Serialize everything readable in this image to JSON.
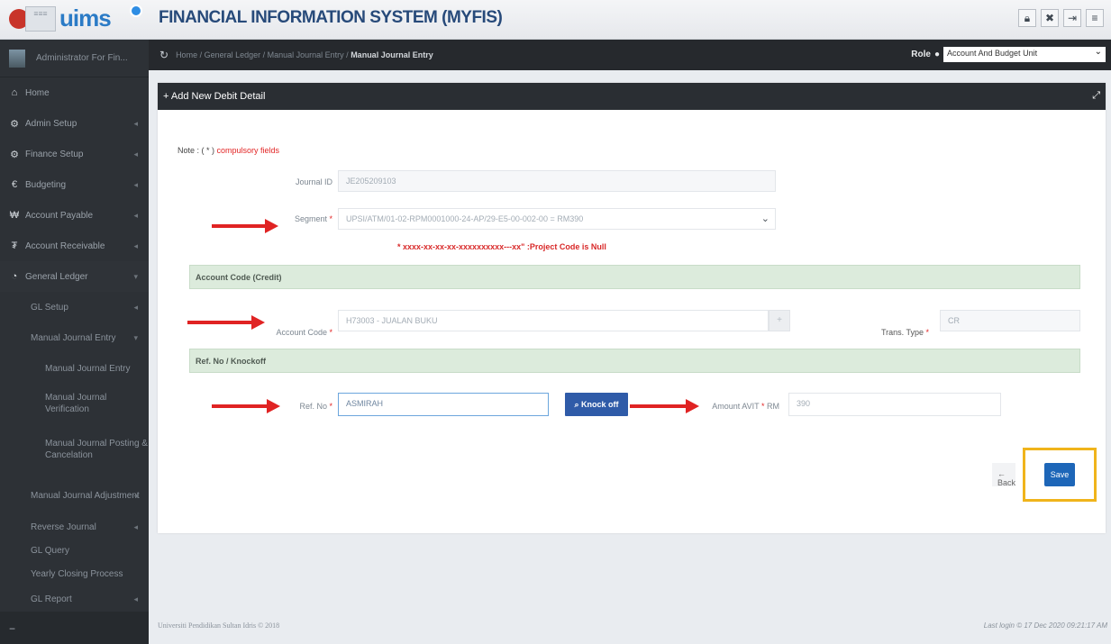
{
  "header": {
    "logo_box_text": "≡≡≡",
    "brand": "uims",
    "system_title": "FINANCIAL INFORMATION SYSTEM (MYFIS)",
    "icons": [
      "lock-icon",
      "settings-icon",
      "logout-icon",
      "menu-icon"
    ]
  },
  "sidebar": {
    "user": "Administrator For Fin...",
    "items": [
      {
        "label": "Home"
      },
      {
        "label": "Admin Setup"
      },
      {
        "label": "Finance Setup"
      },
      {
        "label": "Budgeting"
      },
      {
        "label": "Account Payable"
      },
      {
        "label": "Account Receivable"
      },
      {
        "label": "General Ledger"
      }
    ],
    "sub_items": [
      {
        "label": "GL Setup"
      },
      {
        "label": "Manual Journal Entry"
      }
    ],
    "subsub_items": [
      {
        "label": "Manual Journal Entry"
      },
      {
        "label": "Manual Journal Verification"
      },
      {
        "label": "Manual Journal Posting & Cancelation"
      }
    ],
    "more_items": [
      {
        "label": "Manual Journal Adjustment"
      },
      {
        "label": "Reverse Journal"
      },
      {
        "label": "GL Query"
      },
      {
        "label": "Yearly Closing Process"
      },
      {
        "label": "GL Report"
      }
    ]
  },
  "breadcrumb": {
    "path": "Home / General Ledger / Manual Journal Entry /",
    "current": "Manual Journal Entry",
    "role_label": "Role",
    "role_value": "Account And Budget Unit"
  },
  "panel": {
    "title": "+ Add New Debit Detail",
    "note_prefix": "Note : ( * )",
    "note_text": "compulsory fields",
    "journal_id_label": "Journal ID",
    "journal_id_value": "JE205209103",
    "segment_label": "Segment",
    "segment_value": "UPSI/ATM/01-02-RPM0001000-24-AP/29-E5-00-002-00 = RM390",
    "segment_warning": "* xxxx-xx-xx-xx-xxxxxxxxxx---xx\" :Project Code is Null",
    "section_account": "Account Code (Credit)",
    "account_label": "Account Code",
    "account_value": "H73003 - JUALAN BUKU",
    "plus_symbol": "+",
    "trans_type_label": "Trans. Type",
    "trans_type_value": "CR",
    "section_ref": "Ref. No / Knockoff",
    "ref_label": "Ref. No",
    "ref_value": "ASMIRAH",
    "knock_off_label": "Knock off",
    "amount_label": "Amount AVIT",
    "amount_unit": "RM",
    "amount_value": "390",
    "back_label": "← Back",
    "save_label": "Save"
  },
  "footer": {
    "left": "Universiti Pendidikan Sultan Idris © 2018",
    "right": "Last login © 17 Dec 2020 09:21:17 AM"
  }
}
